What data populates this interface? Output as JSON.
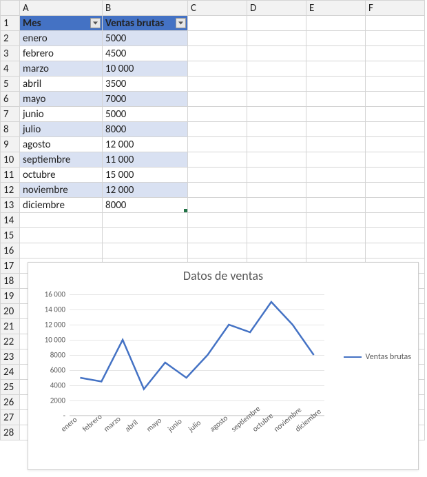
{
  "columns": [
    "A",
    "B",
    "C",
    "D",
    "E",
    "F"
  ],
  "table": {
    "headerA": "Mes",
    "headerB": "Ventas brutas",
    "rows": [
      {
        "mes": "enero",
        "val": "5000"
      },
      {
        "mes": "febrero",
        "val": "4500"
      },
      {
        "mes": "marzo",
        "val": "10 000"
      },
      {
        "mes": "abril",
        "val": "3500"
      },
      {
        "mes": "mayo",
        "val": "7000"
      },
      {
        "mes": "junio",
        "val": "5000"
      },
      {
        "mes": "julio",
        "val": "8000"
      },
      {
        "mes": "agosto",
        "val": "12 000"
      },
      {
        "mes": "septiembre",
        "val": "11 000"
      },
      {
        "mes": "octubre",
        "val": "15 000"
      },
      {
        "mes": "noviembre",
        "val": "12 000"
      },
      {
        "mes": "diciembre",
        "val": "8000"
      }
    ]
  },
  "chart_data": {
    "type": "line",
    "title": "Datos de ventas",
    "legend": "Ventas brutas",
    "y_ticks": [
      "16 000",
      "14 000",
      "12 000",
      "10 000",
      "8000",
      "6000",
      "4000",
      "2000",
      "-"
    ],
    "ylim": [
      0,
      16000
    ],
    "categories": [
      "enero",
      "febrero",
      "marzo",
      "abril",
      "mayo",
      "junio",
      "julio",
      "agosto",
      "septiembre",
      "octubre",
      "noviembre",
      "diciembre"
    ],
    "values": [
      5000,
      4500,
      10000,
      3500,
      7000,
      5000,
      8000,
      12000,
      11000,
      15000,
      12000,
      8000
    ]
  }
}
